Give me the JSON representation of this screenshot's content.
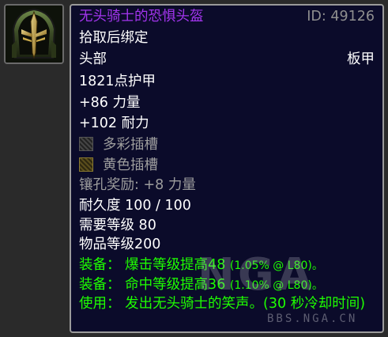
{
  "item": {
    "name": "无头骑士的恐惧头盔",
    "id_label": "ID: 49126",
    "binding": "拾取后绑定",
    "slot": "头部",
    "armor_type": "板甲",
    "armor": "1821点护甲",
    "stats": [
      "+86 力量",
      "+102 耐力"
    ],
    "sockets": [
      {
        "label": "多彩插槽",
        "icon": "prismatic-socket-icon"
      },
      {
        "label": "黄色插槽",
        "icon": "yellow-socket-icon"
      }
    ],
    "socket_bonus": "镶孔奖励: +8 力量",
    "durability": "耐久度 100 / 100",
    "required_level": "需要等级 80",
    "item_level": "物品等级200",
    "effects": [
      {
        "prefix": "装备：",
        "text": " 爆击等级提高48 ",
        "detail": "(1.05% @ L80)。"
      },
      {
        "prefix": "装备：",
        "text": " 命中等级提高36 ",
        "detail": "(1.10% @ L80)。"
      }
    ],
    "use": {
      "prefix": "使用：",
      "text": " 发出无头骑士的笑声。(30 秒冷却时间)"
    }
  },
  "colors": {
    "epic": "#a335ee",
    "uncommon": "#1eff00",
    "disabled": "#9d9d9d",
    "background": "#0b0b2a"
  },
  "watermark": {
    "logo": "NGA",
    "site": "BBS.NGA.CN"
  }
}
